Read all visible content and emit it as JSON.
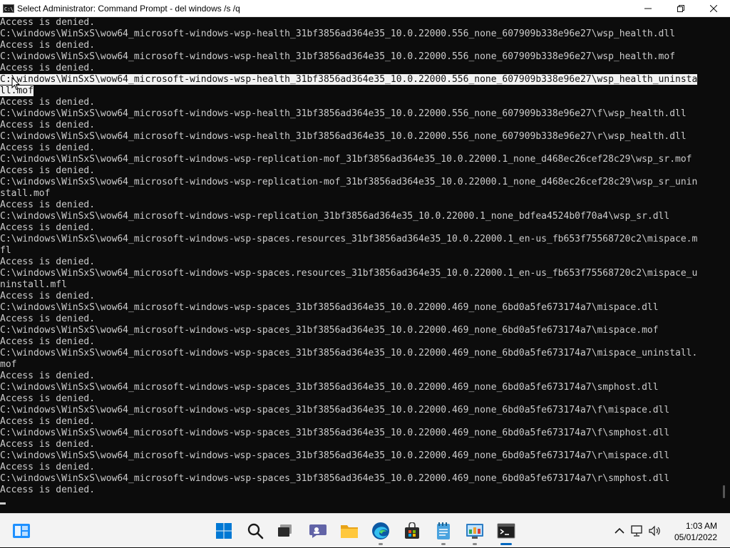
{
  "window": {
    "title": "Select Administrator: Command Prompt - del  windows /s /q",
    "icon_label": "C:\\",
    "controls": {
      "minimize": "minimize-icon",
      "maximize": "maximize-icon",
      "close": "close-icon"
    }
  },
  "console": {
    "lines": [
      "Access is denied.",
      "C:\\windows\\WinSxS\\wow64_microsoft-windows-wsp-health_31bf3856ad364e35_10.0.22000.556_none_607909b338e96e27\\wsp_health.dll",
      "Access is denied.",
      "C:\\windows\\WinSxS\\wow64_microsoft-windows-wsp-health_31bf3856ad364e35_10.0.22000.556_none_607909b338e96e27\\wsp_health.mof",
      "Access is denied.",
      "C:\\windows\\WinSxS\\wow64_microsoft-windows-wsp-health_31bf3856ad364e35_10.0.22000.556_none_607909b338e96e27\\wsp_health_uninsta",
      "ll.mof",
      "Access is denied.",
      "C:\\windows\\WinSxS\\wow64_microsoft-windows-wsp-health_31bf3856ad364e35_10.0.22000.556_none_607909b338e96e27\\f\\wsp_health.dll",
      "Access is denied.",
      "C:\\windows\\WinSxS\\wow64_microsoft-windows-wsp-health_31bf3856ad364e35_10.0.22000.556_none_607909b338e96e27\\r\\wsp_health.dll",
      "Access is denied.",
      "C:\\windows\\WinSxS\\wow64_microsoft-windows-wsp-replication-mof_31bf3856ad364e35_10.0.22000.1_none_d468ec26cef28c29\\wsp_sr.mof",
      "Access is denied.",
      "C:\\windows\\WinSxS\\wow64_microsoft-windows-wsp-replication-mof_31bf3856ad364e35_10.0.22000.1_none_d468ec26cef28c29\\wsp_sr_unin",
      "stall.mof",
      "Access is denied.",
      "C:\\windows\\WinSxS\\wow64_microsoft-windows-wsp-replication_31bf3856ad364e35_10.0.22000.1_none_bdfea4524b0f70a4\\wsp_sr.dll",
      "Access is denied.",
      "C:\\windows\\WinSxS\\wow64_microsoft-windows-wsp-spaces.resources_31bf3856ad364e35_10.0.22000.1_en-us_fb653f75568720c2\\mispace.m",
      "fl",
      "Access is denied.",
      "C:\\windows\\WinSxS\\wow64_microsoft-windows-wsp-spaces.resources_31bf3856ad364e35_10.0.22000.1_en-us_fb653f75568720c2\\mispace_u",
      "ninstall.mfl",
      "Access is denied.",
      "C:\\windows\\WinSxS\\wow64_microsoft-windows-wsp-spaces_31bf3856ad364e35_10.0.22000.469_none_6bd0a5fe673174a7\\mispace.dll",
      "Access is denied.",
      "C:\\windows\\WinSxS\\wow64_microsoft-windows-wsp-spaces_31bf3856ad364e35_10.0.22000.469_none_6bd0a5fe673174a7\\mispace.mof",
      "Access is denied.",
      "C:\\windows\\WinSxS\\wow64_microsoft-windows-wsp-spaces_31bf3856ad364e35_10.0.22000.469_none_6bd0a5fe673174a7\\mispace_uninstall.",
      "mof",
      "Access is denied.",
      "C:\\windows\\WinSxS\\wow64_microsoft-windows-wsp-spaces_31bf3856ad364e35_10.0.22000.469_none_6bd0a5fe673174a7\\smphost.dll",
      "Access is denied.",
      "C:\\windows\\WinSxS\\wow64_microsoft-windows-wsp-spaces_31bf3856ad364e35_10.0.22000.469_none_6bd0a5fe673174a7\\f\\mispace.dll",
      "Access is denied.",
      "C:\\windows\\WinSxS\\wow64_microsoft-windows-wsp-spaces_31bf3856ad364e35_10.0.22000.469_none_6bd0a5fe673174a7\\f\\smphost.dll",
      "Access is denied.",
      "C:\\windows\\WinSxS\\wow64_microsoft-windows-wsp-spaces_31bf3856ad364e35_10.0.22000.469_none_6bd0a5fe673174a7\\r\\mispace.dll",
      "Access is denied.",
      "C:\\windows\\WinSxS\\wow64_microsoft-windows-wsp-spaces_31bf3856ad364e35_10.0.22000.469_none_6bd0a5fe673174a7\\r\\smphost.dll",
      "Access is denied."
    ],
    "selected_lines": [
      5,
      6
    ]
  },
  "taskbar": {
    "apps": [
      {
        "name": "widgets",
        "icon": "widgets-icon",
        "running": false
      },
      {
        "name": "start",
        "icon": "windows-start-icon",
        "running": false
      },
      {
        "name": "search",
        "icon": "search-icon",
        "running": false
      },
      {
        "name": "task-view",
        "icon": "task-view-icon",
        "running": false
      },
      {
        "name": "chat",
        "icon": "teams-chat-icon",
        "running": false
      },
      {
        "name": "file-explorer",
        "icon": "folder-icon",
        "running": false
      },
      {
        "name": "edge",
        "icon": "edge-icon",
        "running": true
      },
      {
        "name": "store",
        "icon": "store-icon",
        "running": false
      },
      {
        "name": "notepad",
        "icon": "notepad-icon",
        "running": true
      },
      {
        "name": "control-panel",
        "icon": "control-panel-icon",
        "running": true
      },
      {
        "name": "command-prompt",
        "icon": "terminal-icon",
        "running": true,
        "active": true
      }
    ],
    "tray": {
      "icons": [
        "chevron-up-icon",
        "network-icon",
        "volume-icon"
      ]
    },
    "clock": {
      "time": "1:03 AM",
      "date": "05/01/2022"
    }
  },
  "colors": {
    "console_bg": "#0c0c0c",
    "console_fg": "#cccccc",
    "selection_bg": "#f2f2f2",
    "taskbar_bg": "#f3f3f3",
    "accent": "#0067c0"
  }
}
